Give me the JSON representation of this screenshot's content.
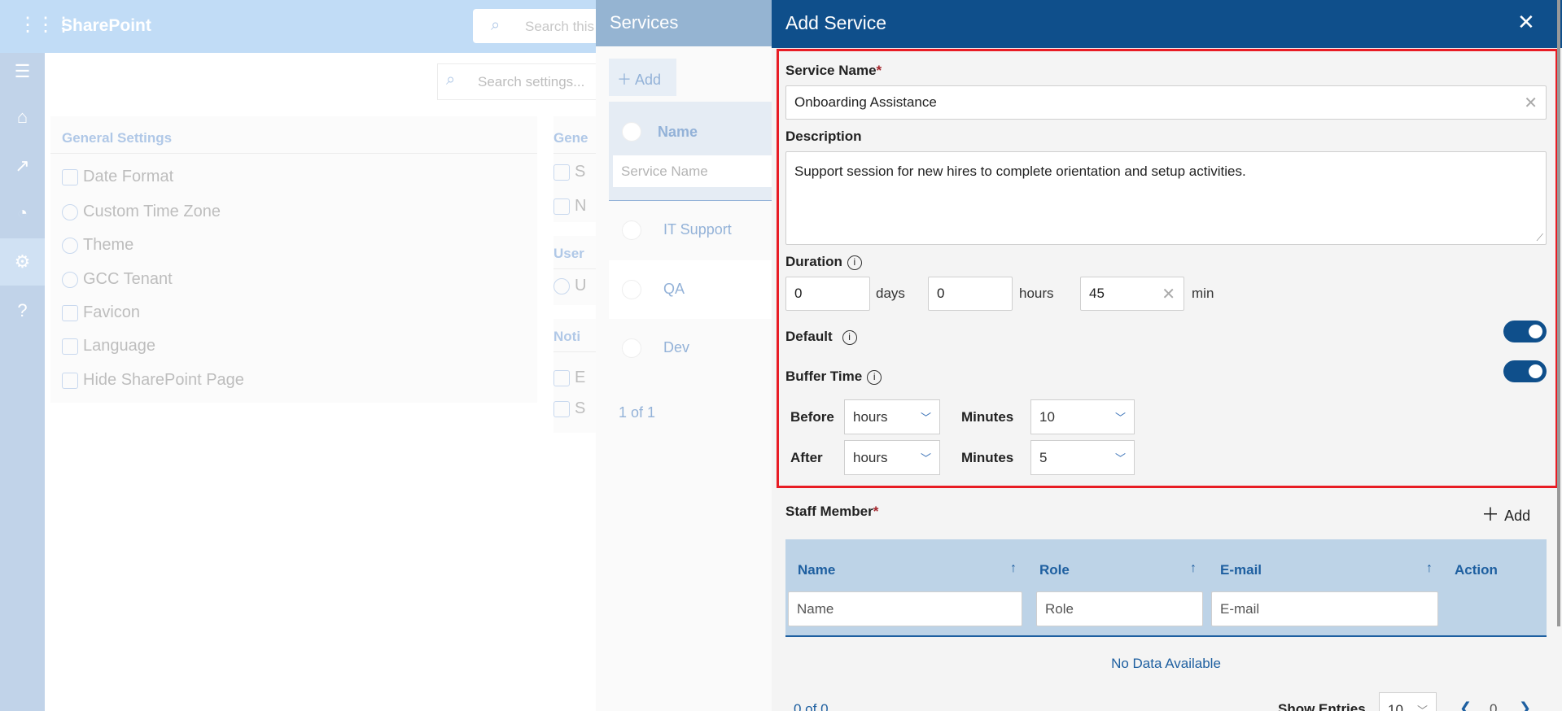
{
  "topbar": {
    "app_name": "SharePoint",
    "search_placeholder": "Search this"
  },
  "rail": {
    "items": [
      "menu-icon",
      "home-icon",
      "chart-icon",
      "palette-icon",
      "gear-icon",
      "help-icon"
    ],
    "selected": "gear-icon"
  },
  "settings": {
    "search_placeholder": "Search settings...",
    "general": {
      "title": "General Settings",
      "items": [
        "Date Format",
        "Custom Time Zone",
        "Theme",
        "GCC Tenant",
        "Favicon",
        "Language",
        "Hide SharePoint Page"
      ]
    },
    "col2": {
      "general_title": "Gene",
      "general_items": [
        "S",
        "N"
      ],
      "user_title": "User",
      "user_items": [
        "U"
      ],
      "noti_title": "Noti",
      "noti_items": [
        "E",
        "S"
      ]
    }
  },
  "services": {
    "title": "Services",
    "add_label": "Add",
    "col_name": "Name",
    "filter_placeholder": "Service Name",
    "rows": [
      "IT Support",
      "QA",
      "Dev"
    ],
    "pagination": "1 of 1"
  },
  "add_service": {
    "title": "Add Service",
    "service_name_label": "Service Name",
    "required_mark": "*",
    "service_name_value": "Onboarding Assistance",
    "description_label": "Description",
    "description_value": "Support session for new hires to complete orientation and setup activities.",
    "duration_label": "Duration",
    "days_value": "0",
    "days_unit": "days",
    "hours_value": "0",
    "hours_unit": "hours",
    "min_value": "45",
    "min_unit": "min",
    "default_label": "Default",
    "default_on": true,
    "buffer_label": "Buffer Time",
    "buffer_on": true,
    "before_label": "Before",
    "after_label": "After",
    "minutes_label": "Minutes",
    "before_unit": "hours",
    "before_minutes": "10",
    "after_unit": "hours",
    "after_minutes": "5",
    "staff_label": "Staff Member",
    "staff_add": "Add",
    "table": {
      "columns": [
        "Name",
        "Role",
        "E-mail",
        "Action"
      ],
      "filters": [
        "Name",
        "Role",
        "E-mail"
      ],
      "empty": "No Data Available"
    },
    "footer": {
      "count": "0 of 0",
      "show_entries": "Show Entries",
      "entries_value": "10",
      "page": "0"
    }
  },
  "colors": {
    "header": "#0f4f8b",
    "highlight_border": "#e81c24",
    "link": "#1e5fa0"
  }
}
